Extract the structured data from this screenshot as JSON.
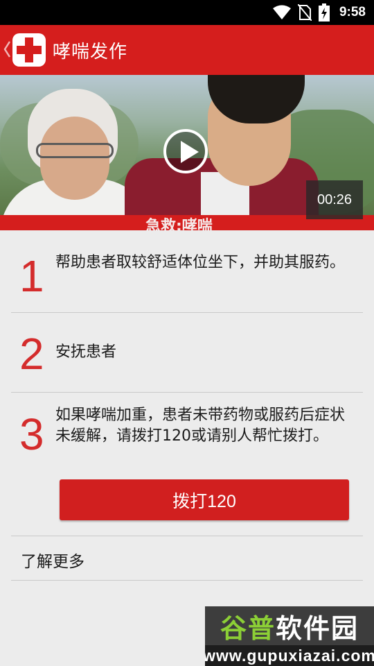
{
  "status_bar": {
    "time": "9:58",
    "icons": [
      "wifi-icon",
      "no-sim-icon",
      "battery-charging-icon"
    ]
  },
  "app_bar": {
    "title": "哮喘发作",
    "back_icon": "chevron-left-icon",
    "logo_icon": "red-cross-icon",
    "background_color": "#d51e1d"
  },
  "video": {
    "caption": "急救:哮喘",
    "duration": "00:26",
    "play_icon": "play-icon"
  },
  "steps": [
    {
      "number": "1",
      "text": "帮助患者取较舒适体位坐下，并助其服药。"
    },
    {
      "number": "2",
      "text": "安抚患者"
    },
    {
      "number": "3",
      "text": "如果哮喘加重，患者未带药物或服药后症状未缓解，请拨打120或请别人帮忙拨打。"
    }
  ],
  "call_button": {
    "label": "拨打120",
    "color": "#d11f1f"
  },
  "learn_more": {
    "label": "了解更多"
  },
  "watermark": {
    "title_green": "谷普",
    "title_white": "软件园",
    "url": "www.gupuxiazai.com"
  }
}
